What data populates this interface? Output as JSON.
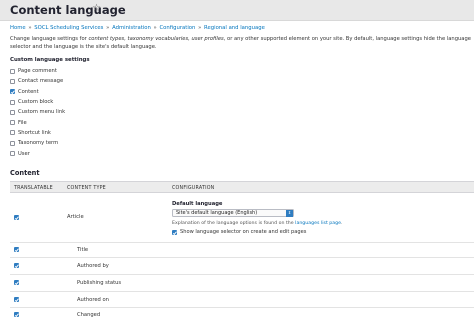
{
  "page": {
    "title": "Content language",
    "star_glyph": "☆"
  },
  "breadcrumb": {
    "items": [
      "Home",
      "SOCL Scheduling Services",
      "Administration",
      "Configuration",
      "Regional and language"
    ],
    "separator": "»"
  },
  "description": {
    "part1": "Change language settings for ",
    "em": "content types, taxonomy vocabularies, user profiles",
    "part2": ", or any other supported element on your site. By default, language settings hide the language selector and the language is the site's default language."
  },
  "custom_settings": {
    "heading": "Custom language settings",
    "items": [
      {
        "label": "Page comment",
        "checked": false
      },
      {
        "label": "Contact message",
        "checked": false
      },
      {
        "label": "Content",
        "checked": true
      },
      {
        "label": "Custom block",
        "checked": false
      },
      {
        "label": "Custom menu link",
        "checked": false
      },
      {
        "label": "File",
        "checked": false
      },
      {
        "label": "Shortcut link",
        "checked": false
      },
      {
        "label": "Taxonomy term",
        "checked": false
      },
      {
        "label": "User",
        "checked": false
      }
    ]
  },
  "content_section": {
    "heading": "Content",
    "columns": [
      "TRANSLATABLE",
      "CONTENT TYPE",
      "CONFIGURATION"
    ],
    "rows": [
      {
        "type": "Article",
        "checked": true
      },
      {
        "type": "Title",
        "checked": true
      },
      {
        "type": "Authored by",
        "checked": true
      },
      {
        "type": "Publishing status",
        "checked": true
      },
      {
        "type": "Authored on",
        "checked": true
      },
      {
        "type": "Changed",
        "checked": true
      }
    ],
    "config": {
      "default_language_label": "Default language",
      "select_value": "Site's default language (English)",
      "explanation_prefix": "Explanation of the language options is found on the ",
      "explanation_link": "languages list page",
      "explanation_suffix": ".",
      "show_selector_label": "Show language selector on create and edit pages",
      "show_selector_checked": true
    }
  },
  "colors": {
    "link": "#0074bd",
    "checkbox_checked": "#2f7dc1",
    "header_bg": "#e8e8e8"
  }
}
